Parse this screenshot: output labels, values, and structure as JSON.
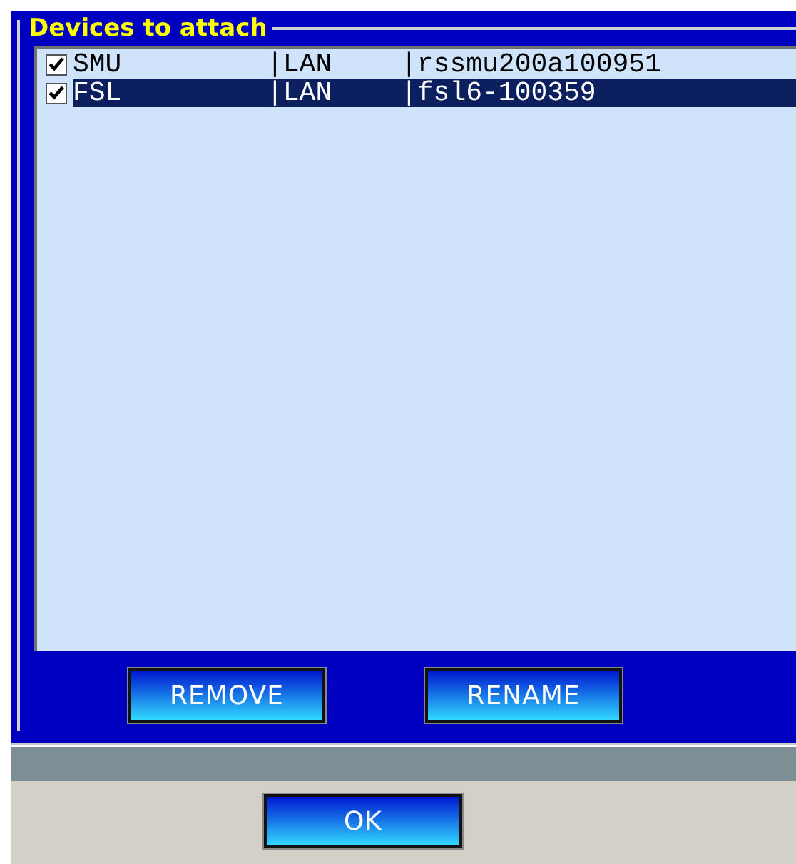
{
  "group": {
    "title": "Devices to attach"
  },
  "devices": [
    {
      "name": "SMU",
      "connection": "|LAN",
      "address": "|rssmu200a100951",
      "checked": true,
      "selected": false
    },
    {
      "name": "FSL",
      "connection": "|LAN",
      "address": "|fsl6-100359",
      "checked": true,
      "selected": true
    }
  ],
  "buttons": [
    "REMOVE",
    "RENAME"
  ],
  "footer_button": "OK"
}
